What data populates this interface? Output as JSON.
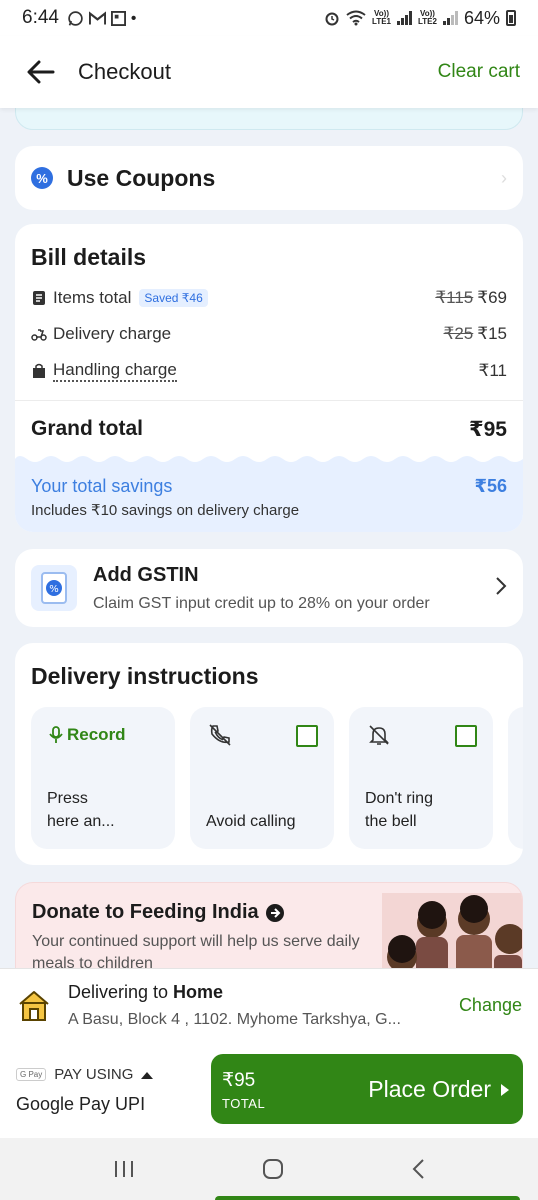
{
  "status_bar": {
    "time": "6:44",
    "battery": "64%",
    "lte1": "LTE1",
    "lte2": "LTE2",
    "volte": "Vo))"
  },
  "header": {
    "title": "Checkout",
    "clear_cart": "Clear cart"
  },
  "coupons": {
    "label": "Use Coupons"
  },
  "bill": {
    "title": "Bill details",
    "items_total": {
      "label": "Items total",
      "saved_badge": "Saved ₹46",
      "original": "₹115",
      "amount": "₹69"
    },
    "delivery_charge": {
      "label": "Delivery charge",
      "original": "₹25",
      "amount": "₹15"
    },
    "handling_charge": {
      "label": "Handling charge",
      "amount": "₹11"
    },
    "grand_total": {
      "label": "Grand total",
      "amount": "₹95"
    },
    "savings": {
      "label": "Your total savings",
      "amount": "₹56",
      "note": "Includes ₹10 savings on delivery charge"
    }
  },
  "gstin": {
    "title": "Add GSTIN",
    "subtitle": "Claim GST input credit up to 28% on your order"
  },
  "delivery_instructions": {
    "title": "Delivery instructions",
    "record": {
      "label": "Record",
      "text_line1": "Press",
      "text_line2": "here an..."
    },
    "avoid_calling": {
      "label": "Avoid calling",
      "checked": false
    },
    "dont_ring": {
      "label_line1": "Don't ring",
      "label_line2": "the bell",
      "checked": false
    }
  },
  "donate": {
    "title": "Donate to Feeding India",
    "subtitle": "Your continued support will help us serve daily meals to children"
  },
  "address": {
    "prefix": "Delivering to ",
    "place": "Home",
    "line": "A Basu, Block 4 , 1102. Myhome Tarkshya, G...",
    "change": "Change"
  },
  "payment": {
    "pay_using": "PAY USING",
    "gpay_badge": "G Pay",
    "method": "Google Pay UPI",
    "total_amount": "₹95",
    "total_label": "TOTAL",
    "place_order": "Place Order"
  },
  "colors": {
    "accent_green": "#318616",
    "blue": "#3d7fe0",
    "background": "#eef2f8"
  }
}
